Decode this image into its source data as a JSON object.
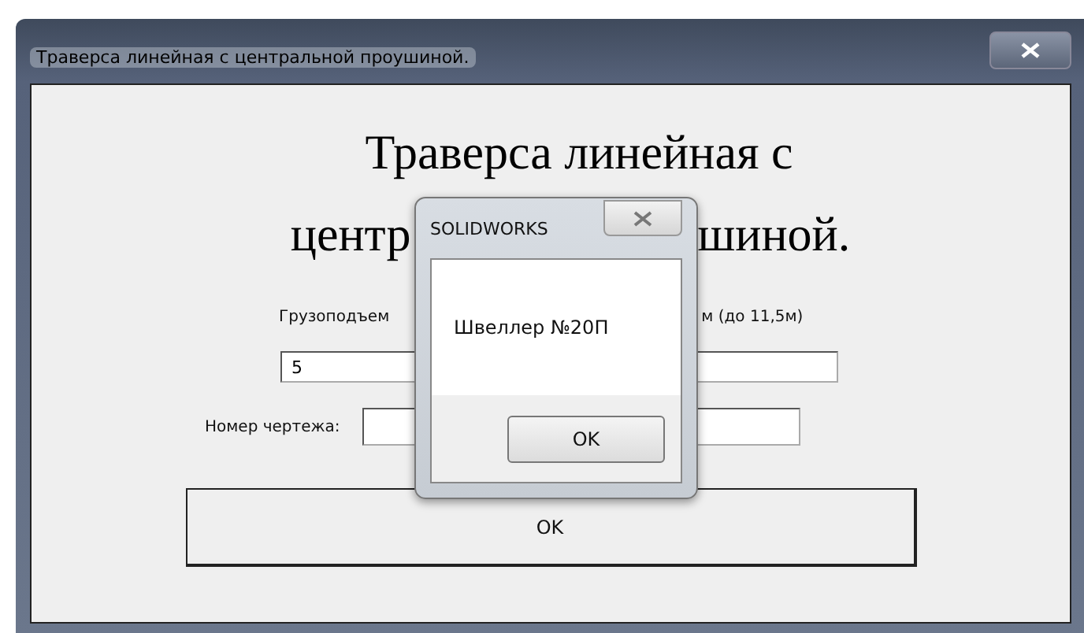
{
  "window": {
    "title": "Траверса линейная с центральной проушиной."
  },
  "heading": {
    "line_1": "Траверса линейная с",
    "line_2_left": "центр",
    "line_2_right": "шиной."
  },
  "capacity": {
    "label_left": "Грузоподъем",
    "label_right": "м (до 11,5м)",
    "value": "5"
  },
  "drawing_number": {
    "label": "Номер чертежа:"
  },
  "ok_button": "OK",
  "message_box": {
    "title": "SOLIDWORKS",
    "message": "Швеллер №20П",
    "button": "OK"
  }
}
